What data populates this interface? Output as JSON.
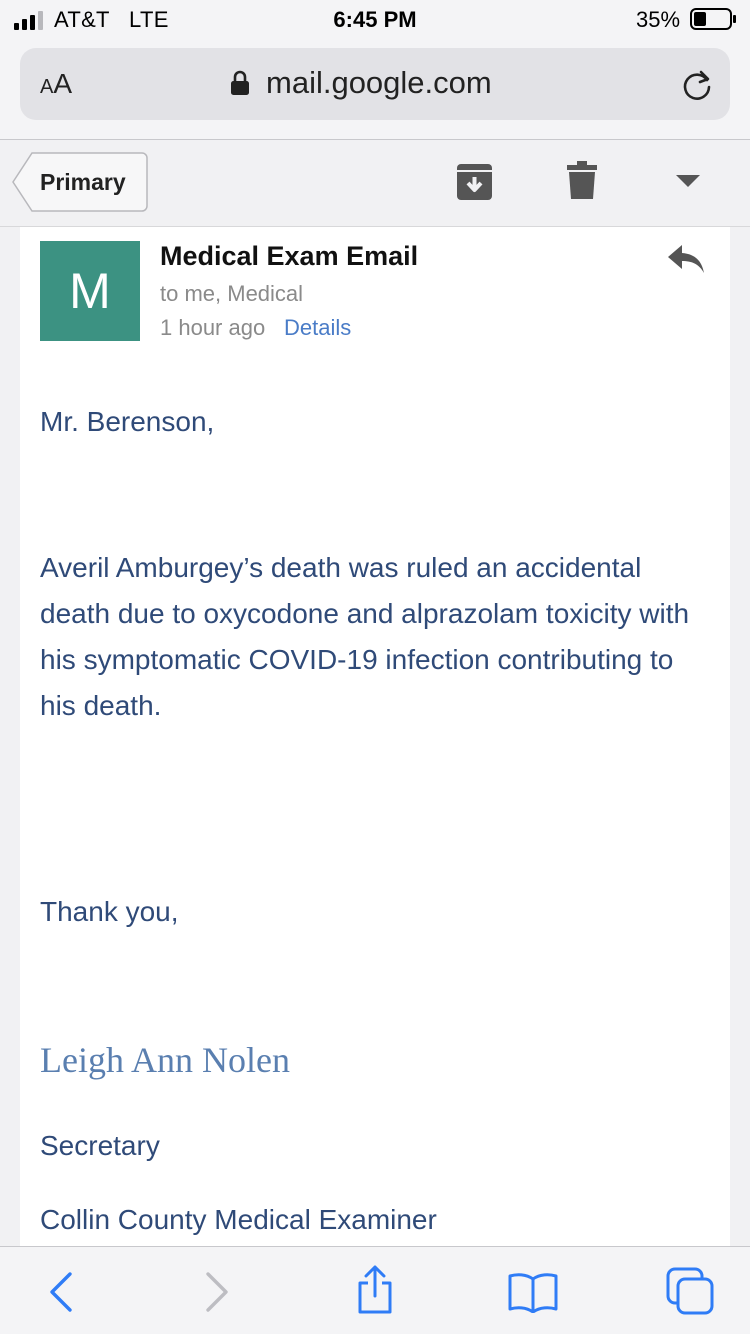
{
  "status_bar": {
    "carrier": "AT&T",
    "network": "LTE",
    "time": "6:45 PM",
    "battery": "35%"
  },
  "browser": {
    "text_size_label_small": "A",
    "text_size_label_large": "A",
    "url": "mail.google.com"
  },
  "toolbar": {
    "back_label": "Primary",
    "icons": [
      "archive-icon",
      "trash-icon",
      "more-dropdown-icon"
    ]
  },
  "email": {
    "avatar_letter": "M",
    "avatar_color": "#3c9282",
    "subject": "Medical Exam Email",
    "recipients": "to me, Medical",
    "time": "1 hour ago",
    "details_link": "Details",
    "greeting": "Mr. Berenson,",
    "body": "Averil Amburgey’s death was ruled an accidental death due to oxycodone and alprazolam toxicity with his symptomatic COVID-19 infection contributing to his death.",
    "closing": "Thank you,",
    "signature_name": "Leigh Ann Nolen",
    "signature_title": "Secretary",
    "signature_org": "Collin County Medical Examiner"
  },
  "bottom_bar": {
    "icons": [
      "back-arrow-icon",
      "forward-arrow-icon",
      "share-icon",
      "bookmarks-icon",
      "tabs-icon"
    ]
  },
  "colors": {
    "link": "#4a7cc7",
    "body_text": "#2f4a78",
    "ios_blue": "#2f7cf6"
  }
}
